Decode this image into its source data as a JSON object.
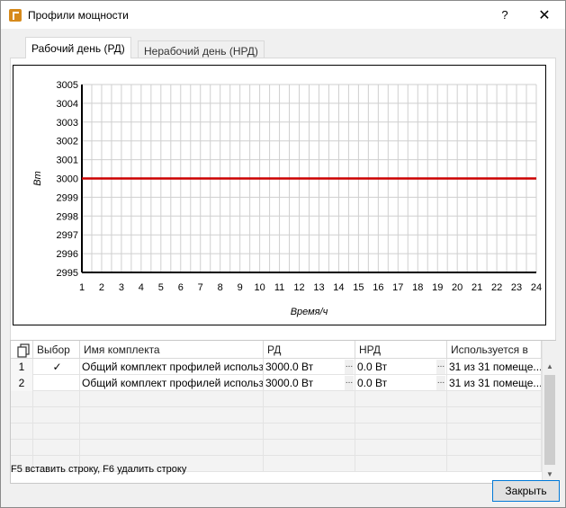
{
  "window": {
    "title": "Профили мощности",
    "help_label": "?",
    "close_label": "✕"
  },
  "tabs": [
    {
      "label": "Рабочий день (РД)",
      "active": true
    },
    {
      "label": "Нерабочий день (НРД)",
      "active": false
    }
  ],
  "chart_data": {
    "type": "line",
    "ylabel": "Вт",
    "xlabel": "Время/ч",
    "x": [
      1,
      2,
      3,
      4,
      5,
      6,
      7,
      8,
      9,
      10,
      11,
      12,
      13,
      14,
      15,
      16,
      17,
      18,
      19,
      20,
      21,
      22,
      23,
      24
    ],
    "series": [
      {
        "values": [
          3000,
          3000,
          3000,
          3000,
          3000,
          3000,
          3000,
          3000,
          3000,
          3000,
          3000,
          3000,
          3000,
          3000,
          3000,
          3000,
          3000,
          3000,
          3000,
          3000,
          3000,
          3000,
          3000,
          3000
        ],
        "color": "#cc0000"
      }
    ],
    "ylim": [
      2995,
      3005
    ],
    "yticks": [
      2995,
      2996,
      2997,
      2998,
      2999,
      3000,
      3001,
      3002,
      3003,
      3004,
      3005
    ],
    "xlim": [
      1,
      24
    ],
    "grid": true
  },
  "table": {
    "columns": [
      "Выбор",
      "Имя комплекта",
      "РД",
      "НРД",
      "Используется в"
    ],
    "rows": [
      {
        "num": "1",
        "check": "✓",
        "name": "Общий комплект профилей использо...",
        "rd": "3000.0 Вт",
        "nrd": "0.0 Вт",
        "used": "31 из 31 помеще..."
      },
      {
        "num": "2",
        "check": "",
        "name": "Общий комплект профилей использо...",
        "rd": "3000.0 Вт",
        "nrd": "0.0 Вт",
        "used": "31 из 31 помеще..."
      }
    ],
    "ellipsis": "..."
  },
  "hint": "F5 вставить строку, F6 удалить строку",
  "close_button": "Закрыть"
}
